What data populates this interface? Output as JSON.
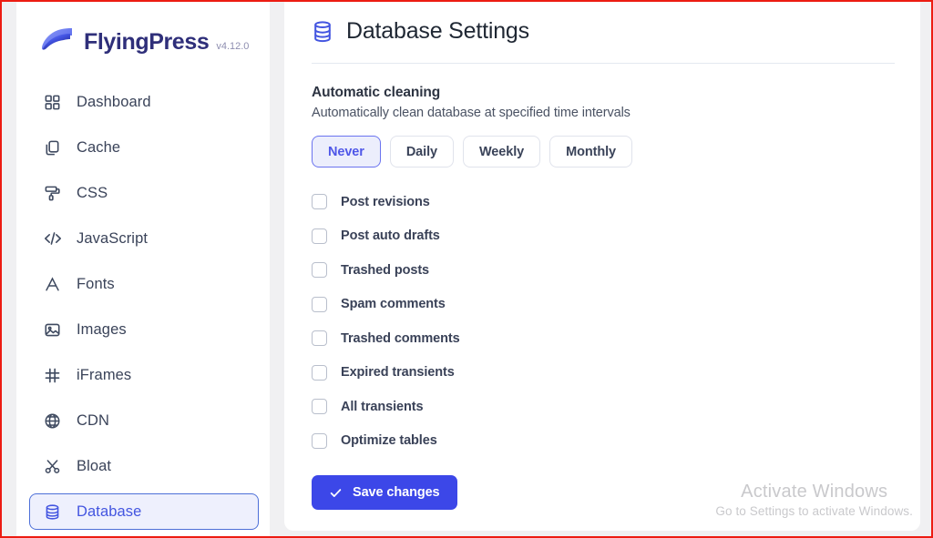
{
  "brand": {
    "name": "FlyingPress",
    "version": "v4.12.0",
    "logo_icon": "wing-logo-icon",
    "logo_color": "#3b49df",
    "text_color": "#2f2f7a"
  },
  "sidebar": {
    "items": [
      {
        "label": "Dashboard",
        "icon": "grid-icon",
        "active": false
      },
      {
        "label": "Cache",
        "icon": "copy-icon",
        "active": false
      },
      {
        "label": "CSS",
        "icon": "paint-roller-icon",
        "active": false
      },
      {
        "label": "JavaScript",
        "icon": "code-icon",
        "active": false
      },
      {
        "label": "Fonts",
        "icon": "letter-a-icon",
        "active": false
      },
      {
        "label": "Images",
        "icon": "image-icon",
        "active": false
      },
      {
        "label": "iFrames",
        "icon": "frame-icon",
        "active": false
      },
      {
        "label": "CDN",
        "icon": "globe-icon",
        "active": false
      },
      {
        "label": "Bloat",
        "icon": "scissors-icon",
        "active": false
      },
      {
        "label": "Database",
        "icon": "database-icon",
        "active": true
      }
    ],
    "active_bg": "#eef0fd",
    "active_border": "#4d6fd8",
    "active_text": "#4355e0"
  },
  "header": {
    "title": "Database Settings",
    "icon": "database-icon",
    "icon_color": "#4355e0"
  },
  "section": {
    "title": "Automatic cleaning",
    "description": "Automatically clean database at specified time intervals",
    "intervals": [
      {
        "label": "Never",
        "selected": true
      },
      {
        "label": "Daily",
        "selected": false
      },
      {
        "label": "Weekly",
        "selected": false
      },
      {
        "label": "Monthly",
        "selected": false
      }
    ],
    "selected_interval": "Never",
    "cleanup_options": [
      {
        "label": "Post revisions",
        "checked": false
      },
      {
        "label": "Post auto drafts",
        "checked": false
      },
      {
        "label": "Trashed posts",
        "checked": false
      },
      {
        "label": "Spam comments",
        "checked": false
      },
      {
        "label": "Trashed comments",
        "checked": false
      },
      {
        "label": "Expired transients",
        "checked": false
      },
      {
        "label": "All transients",
        "checked": false
      },
      {
        "label": "Optimize tables",
        "checked": false
      }
    ]
  },
  "actions": {
    "save_label": "Save changes",
    "save_icon": "check-icon",
    "save_color": "#3c47e8"
  },
  "watermark": {
    "title": "Activate Windows",
    "subtitle": "Go to Settings to activate Windows."
  }
}
